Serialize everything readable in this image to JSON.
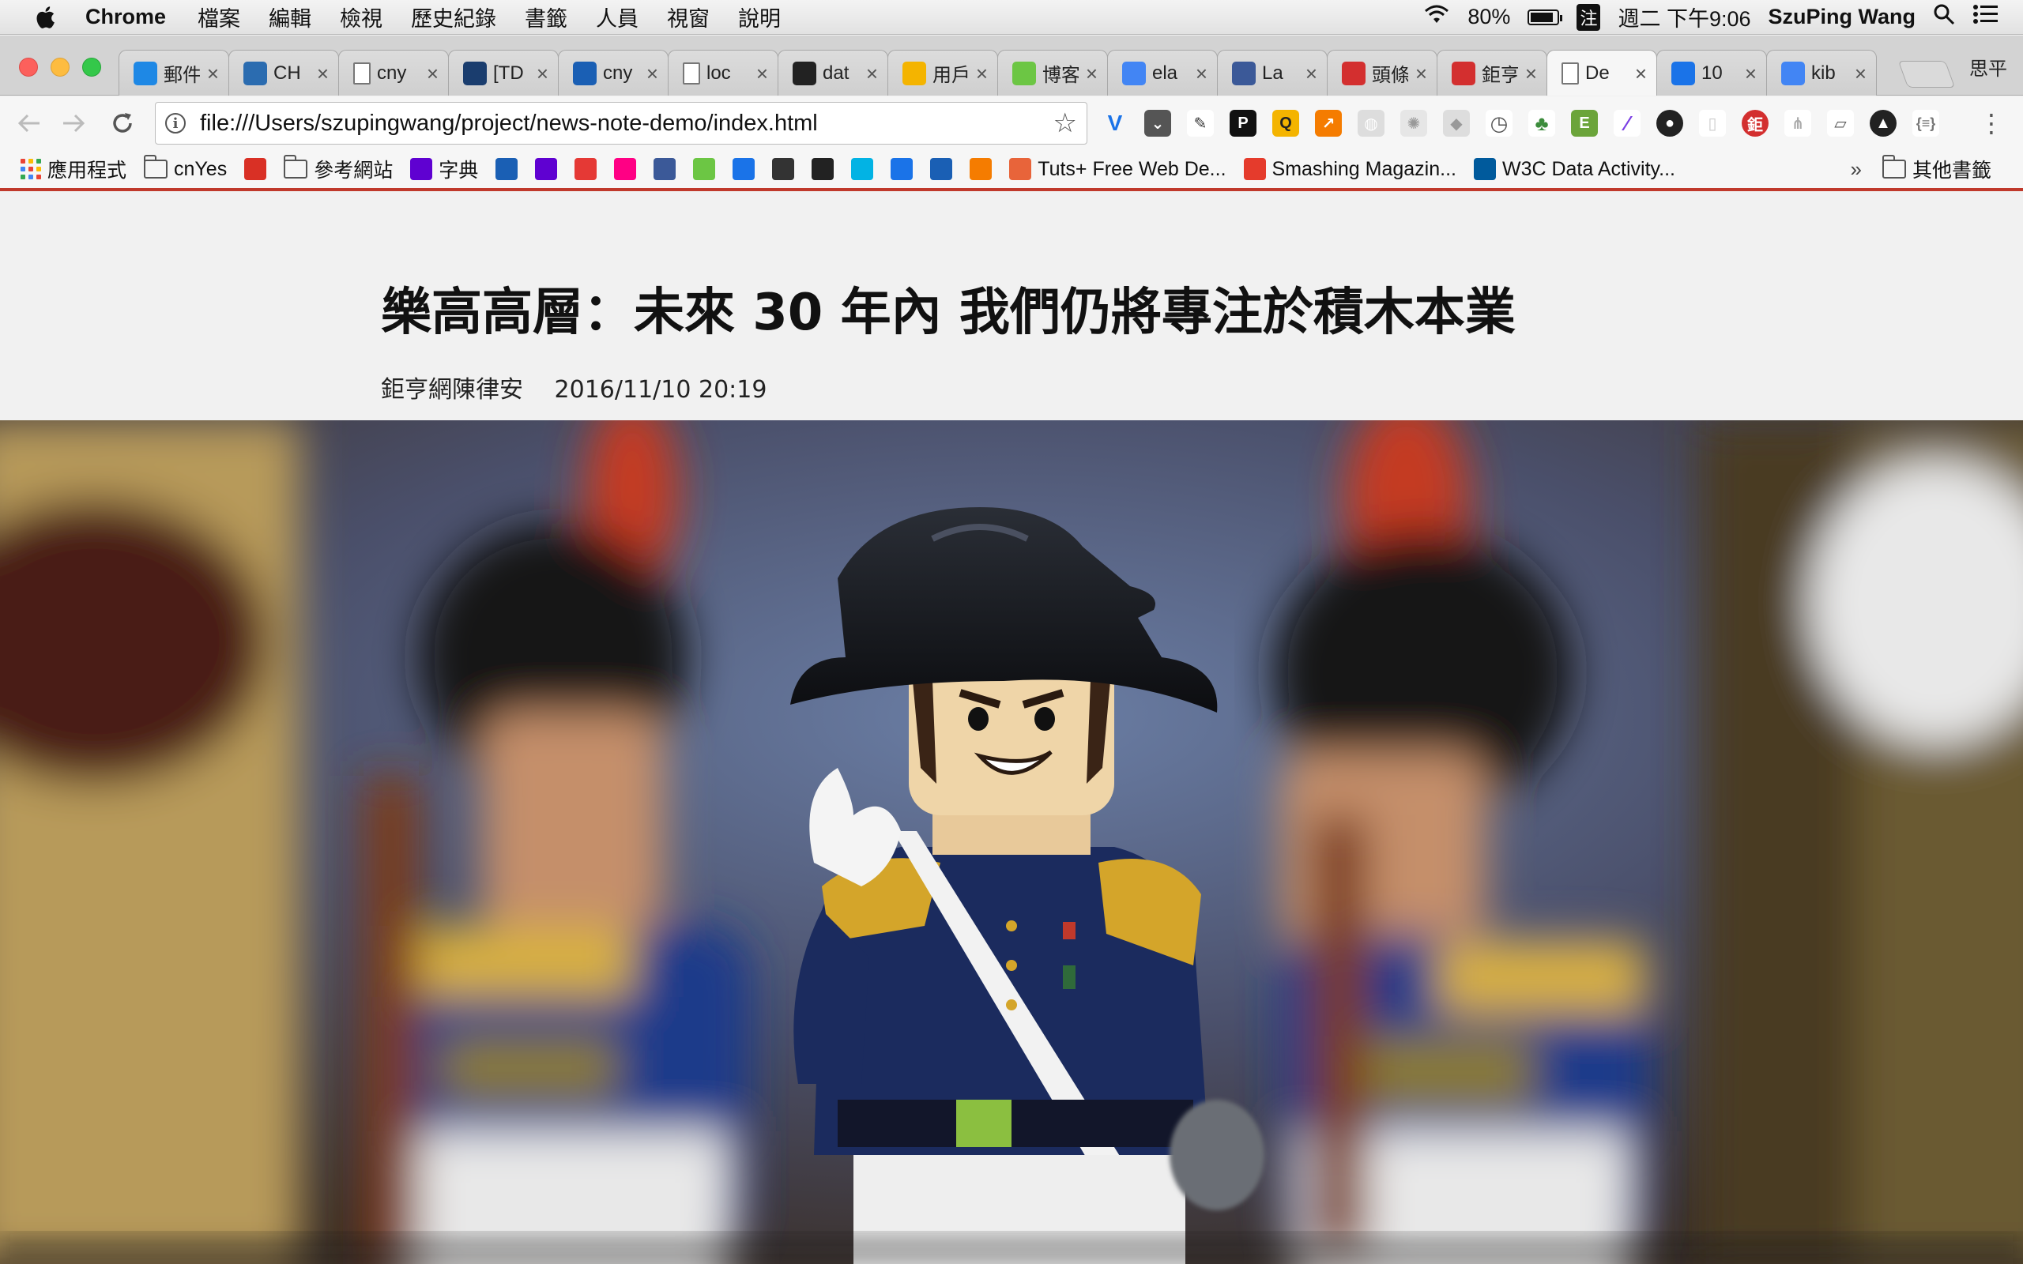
{
  "menubar": {
    "app_name": "Chrome",
    "menus": [
      "檔案",
      "編輯",
      "檢視",
      "歷史紀錄",
      "書籤",
      "人員",
      "視窗",
      "說明"
    ],
    "battery": "80%",
    "input_method": "注",
    "datetime": "週二 下午9:06",
    "user": "SzuPing Wang"
  },
  "tabs": [
    {
      "title": "郵件",
      "favicon": "mail-icon",
      "color": "#1e88e5"
    },
    {
      "title": "CH",
      "favicon": "ch-icon",
      "color": "#2b6cb0"
    },
    {
      "title": "cny",
      "favicon": "page-icon",
      "color": "#ffffff"
    },
    {
      "title": "[TD",
      "favicon": "jenkins-icon",
      "color": "#1a3d6e"
    },
    {
      "title": "cny",
      "favicon": "db-icon",
      "color": "#1a5fb4"
    },
    {
      "title": "loc",
      "favicon": "page-icon",
      "color": "#ffffff"
    },
    {
      "title": "dat",
      "favicon": "github-icon",
      "color": "#222222"
    },
    {
      "title": "用戶",
      "favicon": "slides-icon",
      "color": "#f4b400"
    },
    {
      "title": "博客",
      "favicon": "mail-green-icon",
      "color": "#6cc644"
    },
    {
      "title": "ela",
      "favicon": "google-icon",
      "color": "#4285f4"
    },
    {
      "title": "La",
      "favicon": "facebook-icon",
      "color": "#3b5998"
    },
    {
      "title": "頭條",
      "favicon": "cnyes-icon",
      "color": "#d32f2f"
    },
    {
      "title": "鉅亨",
      "favicon": "cnyes-icon",
      "color": "#d32f2f"
    },
    {
      "title": "De",
      "favicon": "page-icon",
      "color": "#ffffff",
      "active": true
    },
    {
      "title": "10",
      "favicon": "sheet-icon",
      "color": "#1a73e8"
    },
    {
      "title": "kib",
      "favicon": "google-icon",
      "color": "#4285f4"
    }
  ],
  "profile_name": "思平",
  "toolbar": {
    "url": "file:///Users/szupingwang/project/news-note-demo/index.html"
  },
  "bookmarks": {
    "apps_label": "應用程式",
    "items": [
      {
        "label": "cnYes",
        "icon": "folder-icon"
      },
      {
        "label": "",
        "icon": "gmail-icon"
      },
      {
        "label": "參考網站",
        "icon": "folder-icon"
      },
      {
        "label": "字典",
        "icon": "yahoo-icon"
      },
      {
        "label": "",
        "icon": "ma-icon"
      },
      {
        "label": "",
        "icon": "yahoo-icon"
      },
      {
        "label": "",
        "icon": "next-icon"
      },
      {
        "label": "",
        "icon": "flickr-icon"
      },
      {
        "label": "",
        "icon": "facebook-icon"
      },
      {
        "label": "",
        "icon": "chat-icon"
      },
      {
        "label": "",
        "icon": "infinity-icon"
      },
      {
        "label": "",
        "icon": "sc-icon"
      },
      {
        "label": "",
        "icon": "github-icon"
      },
      {
        "label": "",
        "icon": "udacity-icon"
      },
      {
        "label": "",
        "icon": "code-icon"
      },
      {
        "label": "",
        "icon": "c-icon"
      },
      {
        "label": "",
        "icon": "s-icon"
      },
      {
        "label": "Tuts+ Free Web De...",
        "icon": "tuts-icon"
      },
      {
        "label": "Smashing Magazin...",
        "icon": "smashing-icon"
      },
      {
        "label": "W3C Data Activity...",
        "icon": "w3c-icon"
      }
    ],
    "overflow": "»",
    "other_label": "其他書籤"
  },
  "article": {
    "headline": "樂高高層：未來 30 年內 我們仍將專注於積木本業",
    "author": "鉅亨網陳律安",
    "datetime": "2016/11/10 20:19"
  },
  "colors": {
    "bookmark_bar_accent": "#c0392b"
  }
}
